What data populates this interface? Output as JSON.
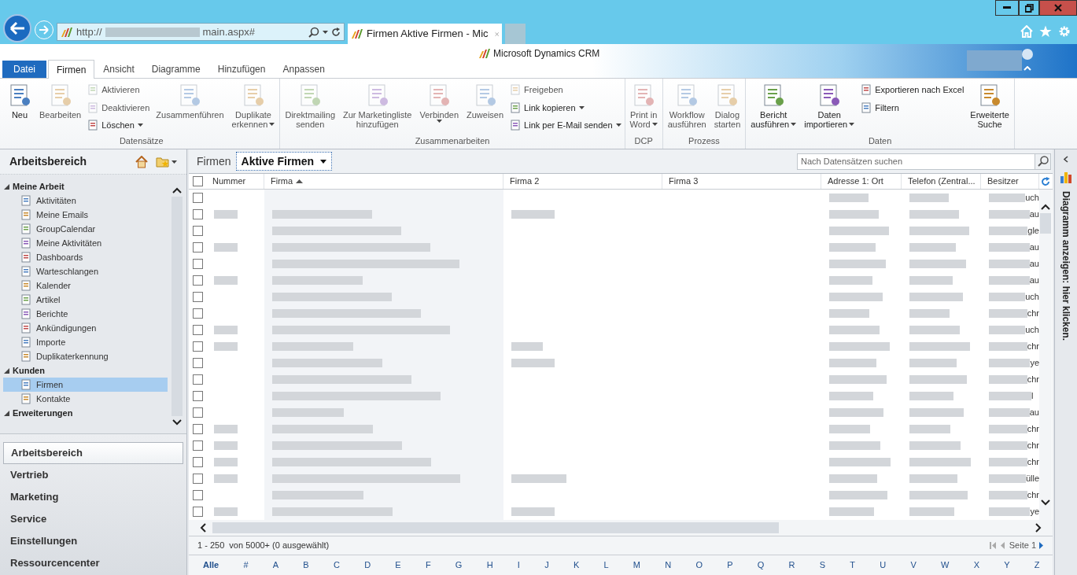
{
  "browser": {
    "url_start": "http://",
    "url_end": "main.aspx#",
    "tab_title": "Firmen Aktive Firmen - Mic"
  },
  "app_title": "Microsoft Dynamics CRM",
  "ribbon_tabs": [
    {
      "label": "Datei",
      "kind": "file",
      "selected": false
    },
    {
      "label": "Firmen",
      "kind": "tab",
      "selected": true
    },
    {
      "label": "Ansicht",
      "kind": "tab",
      "selected": false
    },
    {
      "label": "Diagramme",
      "kind": "tab",
      "selected": false
    },
    {
      "label": "Hinzufügen",
      "kind": "tab",
      "selected": false
    },
    {
      "label": "Anpassen",
      "kind": "tab",
      "selected": false
    }
  ],
  "ribbon_groups": [
    {
      "label": "Datensätze",
      "columns": [
        {
          "kind": "large",
          "lines": [
            "Neu"
          ],
          "disabled": false,
          "dropdown": false
        },
        {
          "kind": "large",
          "lines": [
            "Bearbeiten"
          ],
          "disabled": true,
          "dropdown": false
        },
        {
          "kind": "stack",
          "items": [
            {
              "label": "Aktivieren",
              "disabled": true,
              "dropdown": false
            },
            {
              "label": "Deaktivieren",
              "disabled": true,
              "dropdown": false
            },
            {
              "label": "Löschen",
              "disabled": false,
              "dropdown": true
            }
          ]
        },
        {
          "kind": "large",
          "lines": [
            "Zusammenführen"
          ],
          "disabled": true,
          "dropdown": false
        },
        {
          "kind": "large",
          "lines": [
            "Duplikate",
            "erkennen"
          ],
          "disabled": true,
          "dropdown": true
        }
      ]
    },
    {
      "label": "Zusammenarbeiten",
      "columns": [
        {
          "kind": "large",
          "lines": [
            "Direktmailing",
            "senden"
          ],
          "disabled": true,
          "dropdown": false
        },
        {
          "kind": "large",
          "lines": [
            "Zur Marketingliste",
            "hinzufügen"
          ],
          "disabled": true,
          "dropdown": false
        },
        {
          "kind": "large",
          "lines": [
            "Verbinden"
          ],
          "disabled": true,
          "dropdown": true
        },
        {
          "kind": "large",
          "lines": [
            "Zuweisen"
          ],
          "disabled": true,
          "dropdown": false
        },
        {
          "kind": "stack",
          "items": [
            {
              "label": "Freigeben",
              "disabled": true,
              "dropdown": false
            },
            {
              "label": "Link kopieren",
              "disabled": false,
              "dropdown": true
            },
            {
              "label": "Link per E-Mail senden",
              "disabled": false,
              "dropdown": true
            }
          ]
        }
      ]
    },
    {
      "label": "DCP",
      "columns": [
        {
          "kind": "large",
          "lines": [
            "Print in",
            "Word"
          ],
          "disabled": true,
          "dropdown": true
        }
      ]
    },
    {
      "label": "Prozess",
      "columns": [
        {
          "kind": "large",
          "lines": [
            "Workflow",
            "ausführen"
          ],
          "disabled": true,
          "dropdown": false
        },
        {
          "kind": "large",
          "lines": [
            "Dialog",
            "starten"
          ],
          "disabled": true,
          "dropdown": false
        }
      ]
    },
    {
      "label": "Daten",
      "columns": [
        {
          "kind": "large",
          "lines": [
            "Bericht",
            "ausführen"
          ],
          "disabled": false,
          "dropdown": true
        },
        {
          "kind": "large",
          "lines": [
            "Daten",
            "importieren"
          ],
          "disabled": false,
          "dropdown": true
        },
        {
          "kind": "stack",
          "items": [
            {
              "label": "Exportieren nach Excel",
              "disabled": false,
              "dropdown": false
            },
            {
              "label": "Filtern",
              "disabled": false,
              "dropdown": false
            }
          ]
        },
        {
          "kind": "large",
          "lines": [
            "Erweiterte",
            "Suche"
          ],
          "disabled": false,
          "dropdown": false
        }
      ]
    }
  ],
  "nav": {
    "title": "Arbeitsbereich",
    "sections": [
      {
        "label": "Meine Arbeit",
        "expanded": true,
        "children": [
          {
            "label": "Aktivitäten",
            "selected": false
          },
          {
            "label": "Meine Emails",
            "selected": false
          },
          {
            "label": "GroupCalendar",
            "selected": false
          },
          {
            "label": "Meine Aktivitäten",
            "selected": false
          },
          {
            "label": "Dashboards",
            "selected": false
          },
          {
            "label": "Warteschlangen",
            "selected": false
          },
          {
            "label": "Kalender",
            "selected": false
          },
          {
            "label": "Artikel",
            "selected": false
          },
          {
            "label": "Berichte",
            "selected": false
          },
          {
            "label": "Ankündigungen",
            "selected": false
          },
          {
            "label": "Importe",
            "selected": false
          },
          {
            "label": "Duplikaterkennung",
            "selected": false
          }
        ]
      },
      {
        "label": "Kunden",
        "expanded": true,
        "children": [
          {
            "label": "Firmen",
            "selected": true
          },
          {
            "label": "Kontakte",
            "selected": false
          }
        ]
      },
      {
        "label": "Erweiterungen",
        "expanded": true
      }
    ],
    "areas": [
      {
        "label": "Arbeitsbereich",
        "selected": true
      },
      {
        "label": "Vertrieb",
        "selected": false
      },
      {
        "label": "Marketing",
        "selected": false
      },
      {
        "label": "Service",
        "selected": false
      },
      {
        "label": "Einstellungen",
        "selected": false
      },
      {
        "label": "Ressourcencenter",
        "selected": false
      }
    ]
  },
  "view": {
    "entity": "Firmen",
    "selector": "Aktive Firmen",
    "search_placeholder": "Nach Datensätzen suchen"
  },
  "grid": {
    "all_checked": false,
    "columns": [
      {
        "label": "Nummer",
        "sorted": false
      },
      {
        "label": "Firma",
        "sorted": true
      },
      {
        "label": "Firma 2",
        "sorted": false
      },
      {
        "label": "Firma 3",
        "sorted": false
      },
      {
        "label": "Adresse 1: Ort",
        "sorted": false
      },
      {
        "label": "Telefon (Zentral...",
        "sorted": false
      },
      {
        "label": "Besitzer",
        "sorted": false
      }
    ],
    "rows": [
      {
        "checked": false,
        "besitzer": "uch"
      },
      {
        "checked": false,
        "besitzer": "au"
      },
      {
        "checked": false,
        "besitzer": "gle"
      },
      {
        "checked": false,
        "besitzer": "au"
      },
      {
        "checked": false,
        "besitzer": "au"
      },
      {
        "checked": false,
        "besitzer": "au"
      },
      {
        "checked": false,
        "besitzer": "uch"
      },
      {
        "checked": false,
        "besitzer": "chr"
      },
      {
        "checked": false,
        "besitzer": "uch"
      },
      {
        "checked": false,
        "besitzer": "chr"
      },
      {
        "checked": false,
        "besitzer": "ye"
      },
      {
        "checked": false,
        "besitzer": "chr"
      },
      {
        "checked": false,
        "besitzer": "l"
      },
      {
        "checked": false,
        "besitzer": "au"
      },
      {
        "checked": false,
        "besitzer": "chr"
      },
      {
        "checked": false,
        "besitzer": "chr"
      },
      {
        "checked": false,
        "besitzer": "chr"
      },
      {
        "checked": false,
        "besitzer": "ülle"
      },
      {
        "checked": false,
        "besitzer": "chr"
      },
      {
        "checked": false,
        "besitzer": "ye"
      }
    ]
  },
  "status": "1 - 250  von 5000+ (0 ausgewählt)",
  "pager": "Seite 1",
  "alphabet": [
    {
      "label": "Alle",
      "selected": true
    },
    {
      "label": "#",
      "selected": false
    },
    {
      "label": "A",
      "selected": false
    },
    {
      "label": "B",
      "selected": false
    },
    {
      "label": "C",
      "selected": false
    },
    {
      "label": "D",
      "selected": false
    },
    {
      "label": "E",
      "selected": false
    },
    {
      "label": "F",
      "selected": false
    },
    {
      "label": "G",
      "selected": false
    },
    {
      "label": "H",
      "selected": false
    },
    {
      "label": "I",
      "selected": false
    },
    {
      "label": "J",
      "selected": false
    },
    {
      "label": "K",
      "selected": false
    },
    {
      "label": "L",
      "selected": false
    },
    {
      "label": "M",
      "selected": false
    },
    {
      "label": "N",
      "selected": false
    },
    {
      "label": "O",
      "selected": false
    },
    {
      "label": "P",
      "selected": false
    },
    {
      "label": "Q",
      "selected": false
    },
    {
      "label": "R",
      "selected": false
    },
    {
      "label": "S",
      "selected": false
    },
    {
      "label": "T",
      "selected": false
    },
    {
      "label": "U",
      "selected": false
    },
    {
      "label": "V",
      "selected": false
    },
    {
      "label": "W",
      "selected": false
    },
    {
      "label": "X",
      "selected": false
    },
    {
      "label": "Y",
      "selected": false
    },
    {
      "label": "Z",
      "selected": false
    }
  ],
  "chart_pane": "Diagramm anzeigen: hier klicken."
}
